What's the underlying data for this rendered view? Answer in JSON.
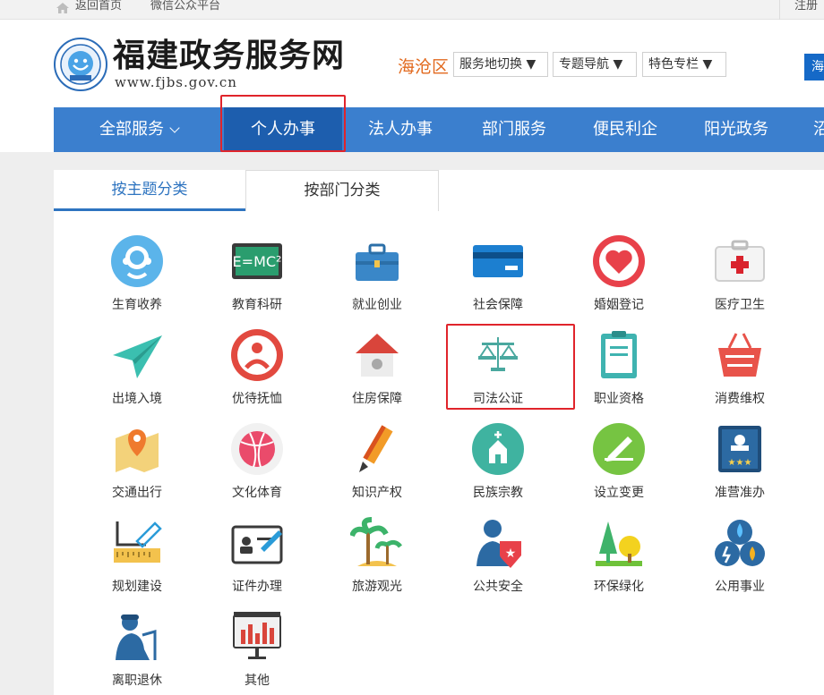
{
  "topbar": {
    "home": "返回首页",
    "wechat": "微信公众平台",
    "register": "注册"
  },
  "header": {
    "title": "福建政务服务网",
    "url": "www.fjbs.gov.cn",
    "region": "海沧区",
    "dropdowns": [
      "服务地切换 ▼",
      "专题导航 ▼",
      "特色专栏 ▼"
    ],
    "edge_button": "海"
  },
  "nav": {
    "items": [
      "全部服务",
      "个人办事",
      "法人办事",
      "部门服务",
      "便民利企",
      "阳光政务",
      "沼"
    ],
    "active": "个人办事"
  },
  "tabs": [
    "按主题分类",
    "按部门分类"
  ],
  "categories": [
    "生育收养",
    "教育科研",
    "就业创业",
    "社会保障",
    "婚姻登记",
    "医疗卫生",
    "出境入境",
    "优待抚恤",
    "住房保障",
    "司法公证",
    "职业资格",
    "消费维权",
    "交通出行",
    "文化体育",
    "知识产权",
    "民族宗教",
    "设立变更",
    "准营准办",
    "规划建设",
    "证件办理",
    "旅游观光",
    "公共安全",
    "环保绿化",
    "公用事业",
    "离职退休",
    "其他"
  ],
  "icons": [
    "birth-adoption-icon",
    "education-icon",
    "employment-icon",
    "social-security-icon",
    "marriage-icon",
    "medical-icon",
    "exit-entry-icon",
    "preferential-icon",
    "housing-icon",
    "judicial-icon",
    "qualification-icon",
    "consumer-icon",
    "transport-icon",
    "culture-sports-icon",
    "intellectual-property-icon",
    "religion-icon",
    "establish-change-icon",
    "permit-icon",
    "planning-icon",
    "certificate-icon",
    "tourism-icon",
    "public-safety-icon",
    "environment-icon",
    "utilities-icon",
    "retirement-icon",
    "other-icon"
  ],
  "colors": {
    "nav_bg": "#3b7fce",
    "nav_active": "#1d5eae",
    "accent": "#2e74c0",
    "region": "#e26a1f",
    "highlight": "#e0242b"
  }
}
